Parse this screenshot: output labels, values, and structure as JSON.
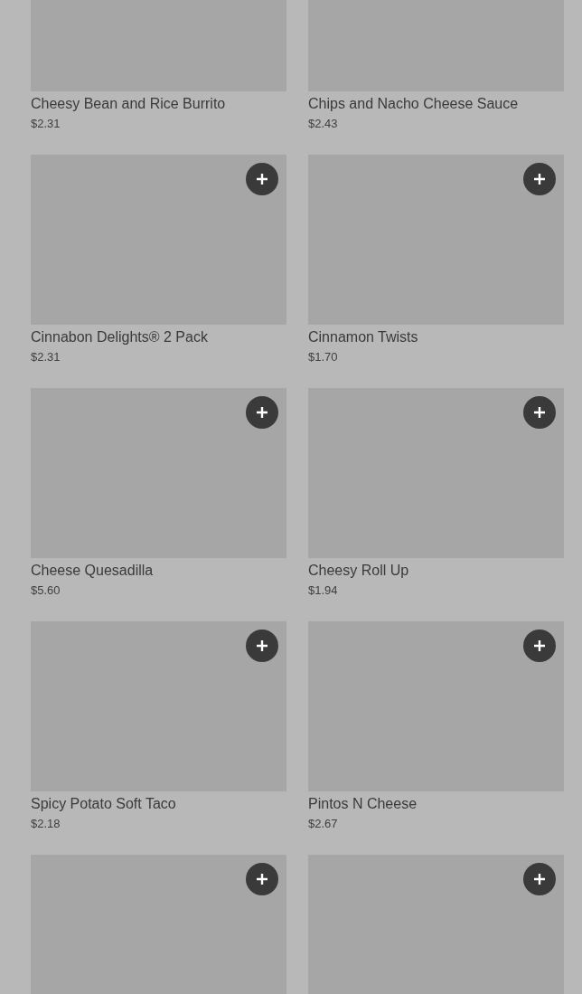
{
  "items": [
    {
      "name": "Cheesy Bean and Rice Burrito",
      "price": "$2.31",
      "add_button": false
    },
    {
      "name": "Chips and Nacho Cheese Sauce",
      "price": "$2.43",
      "add_button": false
    },
    {
      "name": "Cinnabon Delights® 2 Pack",
      "price": "$2.31",
      "add_button": true
    },
    {
      "name": "Cinnamon Twists",
      "price": "$1.70",
      "add_button": true
    },
    {
      "name": "Cheese Quesadilla",
      "price": "$5.60",
      "add_button": true
    },
    {
      "name": "Cheesy Roll Up",
      "price": "$1.94",
      "add_button": true
    },
    {
      "name": "Spicy Potato Soft Taco",
      "price": "$2.18",
      "add_button": true
    },
    {
      "name": "Pintos N Cheese",
      "price": "$2.67",
      "add_button": true
    },
    {
      "add_button": true
    },
    {
      "add_button": true
    }
  ]
}
